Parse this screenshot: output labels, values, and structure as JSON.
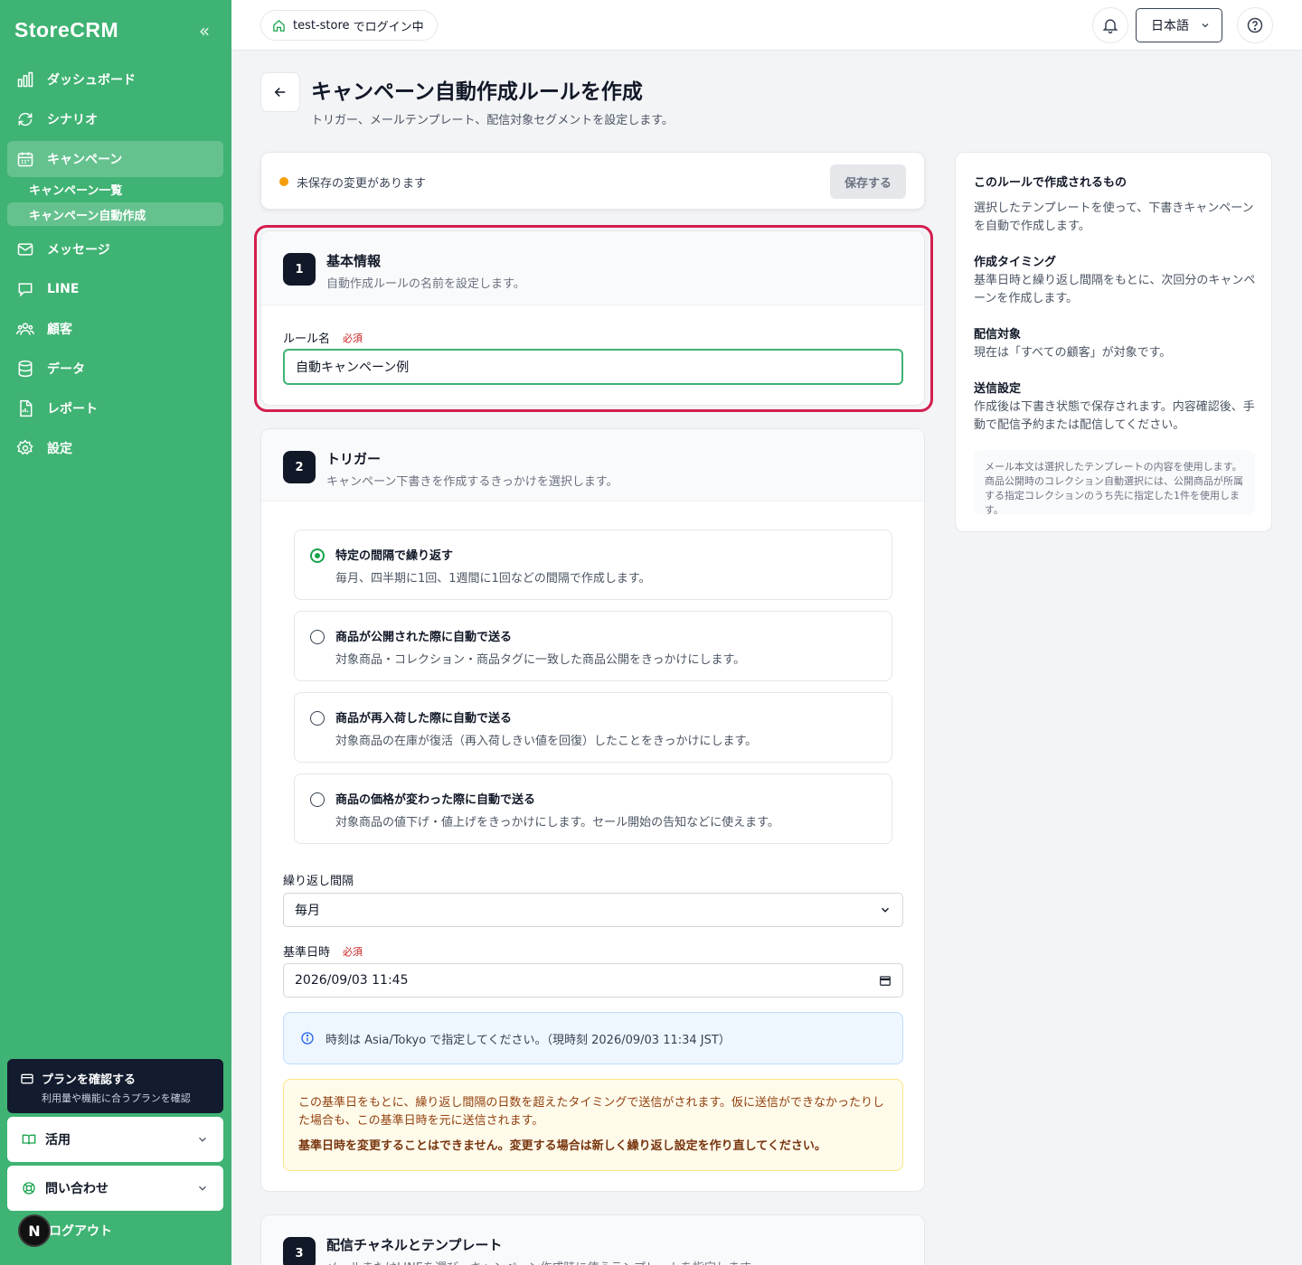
{
  "brand": "StoreCRM",
  "nav": {
    "dashboard": "ダッシュボード",
    "scenario": "シナリオ",
    "campaign": "キャンペーン",
    "campaign_list": "キャンペーン一覧",
    "campaign_auto": "キャンペーン自動作成",
    "message": "メッセージ",
    "line": "LINE",
    "customers": "顧客",
    "data": "データ",
    "report": "レポート",
    "settings": "設定"
  },
  "plan": {
    "title": "プランを確認する",
    "subtitle": "利用量や機能に合うプランを確認"
  },
  "usage": "活用",
  "contact": "問い合わせ",
  "logout": "ログアウト",
  "avatar_initial": "N",
  "topbar": {
    "store_name": "test-store",
    "store_suffix": " でログイン中",
    "language": "日本語"
  },
  "page": {
    "title": "キャンペーン自動作成ルールを作成",
    "subtitle": "トリガー、メールテンプレート、配信対象セグメントを設定します。"
  },
  "save_bar": {
    "status": "未保存の変更があります",
    "save_label": "保存する"
  },
  "section1": {
    "number": "1",
    "title": "基本情報",
    "subtitle": "自動作成ルールの名前を設定します。",
    "rule_name_label": "ルール名",
    "required": "必須",
    "rule_name_value": "自動キャンペーン例"
  },
  "section2": {
    "number": "2",
    "title": "トリガー",
    "subtitle": "キャンペーン下書きを作成するきっかけを選択します。",
    "options": [
      {
        "title": "特定の間隔で繰り返す",
        "desc": "毎月、四半期に1回、1週間に1回などの間隔で作成します。",
        "selected": true
      },
      {
        "title": "商品が公開された際に自動で送る",
        "desc": "対象商品・コレクション・商品タグに一致した商品公開をきっかけにします。",
        "selected": false
      },
      {
        "title": "商品が再入荷した際に自動で送る",
        "desc": "対象商品の在庫が復活（再入荷しきい値を回復）したことをきっかけにします。",
        "selected": false
      },
      {
        "title": "商品の価格が変わった際に自動で送る",
        "desc": "対象商品の値下げ・値上げをきっかけにします。セール開始の告知などに使えます。",
        "selected": false
      }
    ],
    "interval_label": "繰り返し間隔",
    "interval_value": "毎月",
    "base_date_label": "基準日時",
    "required": "必須",
    "base_date_value": "2026/09/03 11:45",
    "info_text": "時刻は Asia/Tokyo で指定してください。（現時刻 2026/09/03 11:34 JST）",
    "warn_text": "この基準日をもとに、繰り返し間隔の日数を超えたタイミングで送信がされます。仮に送信ができなかったりした場合も、この基準日時を元に送信されます。",
    "warn_strong": "基準日時を変更することはできません。変更する場合は新しく繰り返し設定を作り直してください。"
  },
  "section3": {
    "number": "3",
    "title": "配信チャネルとテンプレート",
    "subtitle": "メールまたはLINEを選び、キャンペーン作成時に使うテンプレートを指定します。"
  },
  "side": {
    "h1": "このルールで作成されるもの",
    "p1": "選択したテンプレートを使って、下書きキャンペーンを自動で作成します。",
    "h2": "作成タイミング",
    "p2": "基準日時と繰り返し間隔をもとに、次回分のキャンペーンを作成します。",
    "h3": "配信対象",
    "p3": "現在は「すべての顧客」が対象です。",
    "h4": "送信設定",
    "p4": "作成後は下書き状態で保存されます。内容確認後、手動で配信予約または配信してください。",
    "note": "メール本文は選択したテンプレートの内容を使用します。商品公開時のコレクション自動選択には、公開商品が所属する指定コレクションのうち先に指定した1件を使用します。"
  },
  "colors": {
    "sidebar": "#3fb373",
    "accent": "#16a34a",
    "highlight": "#d41e4f",
    "unsaved_dot": "#f59e0b"
  }
}
